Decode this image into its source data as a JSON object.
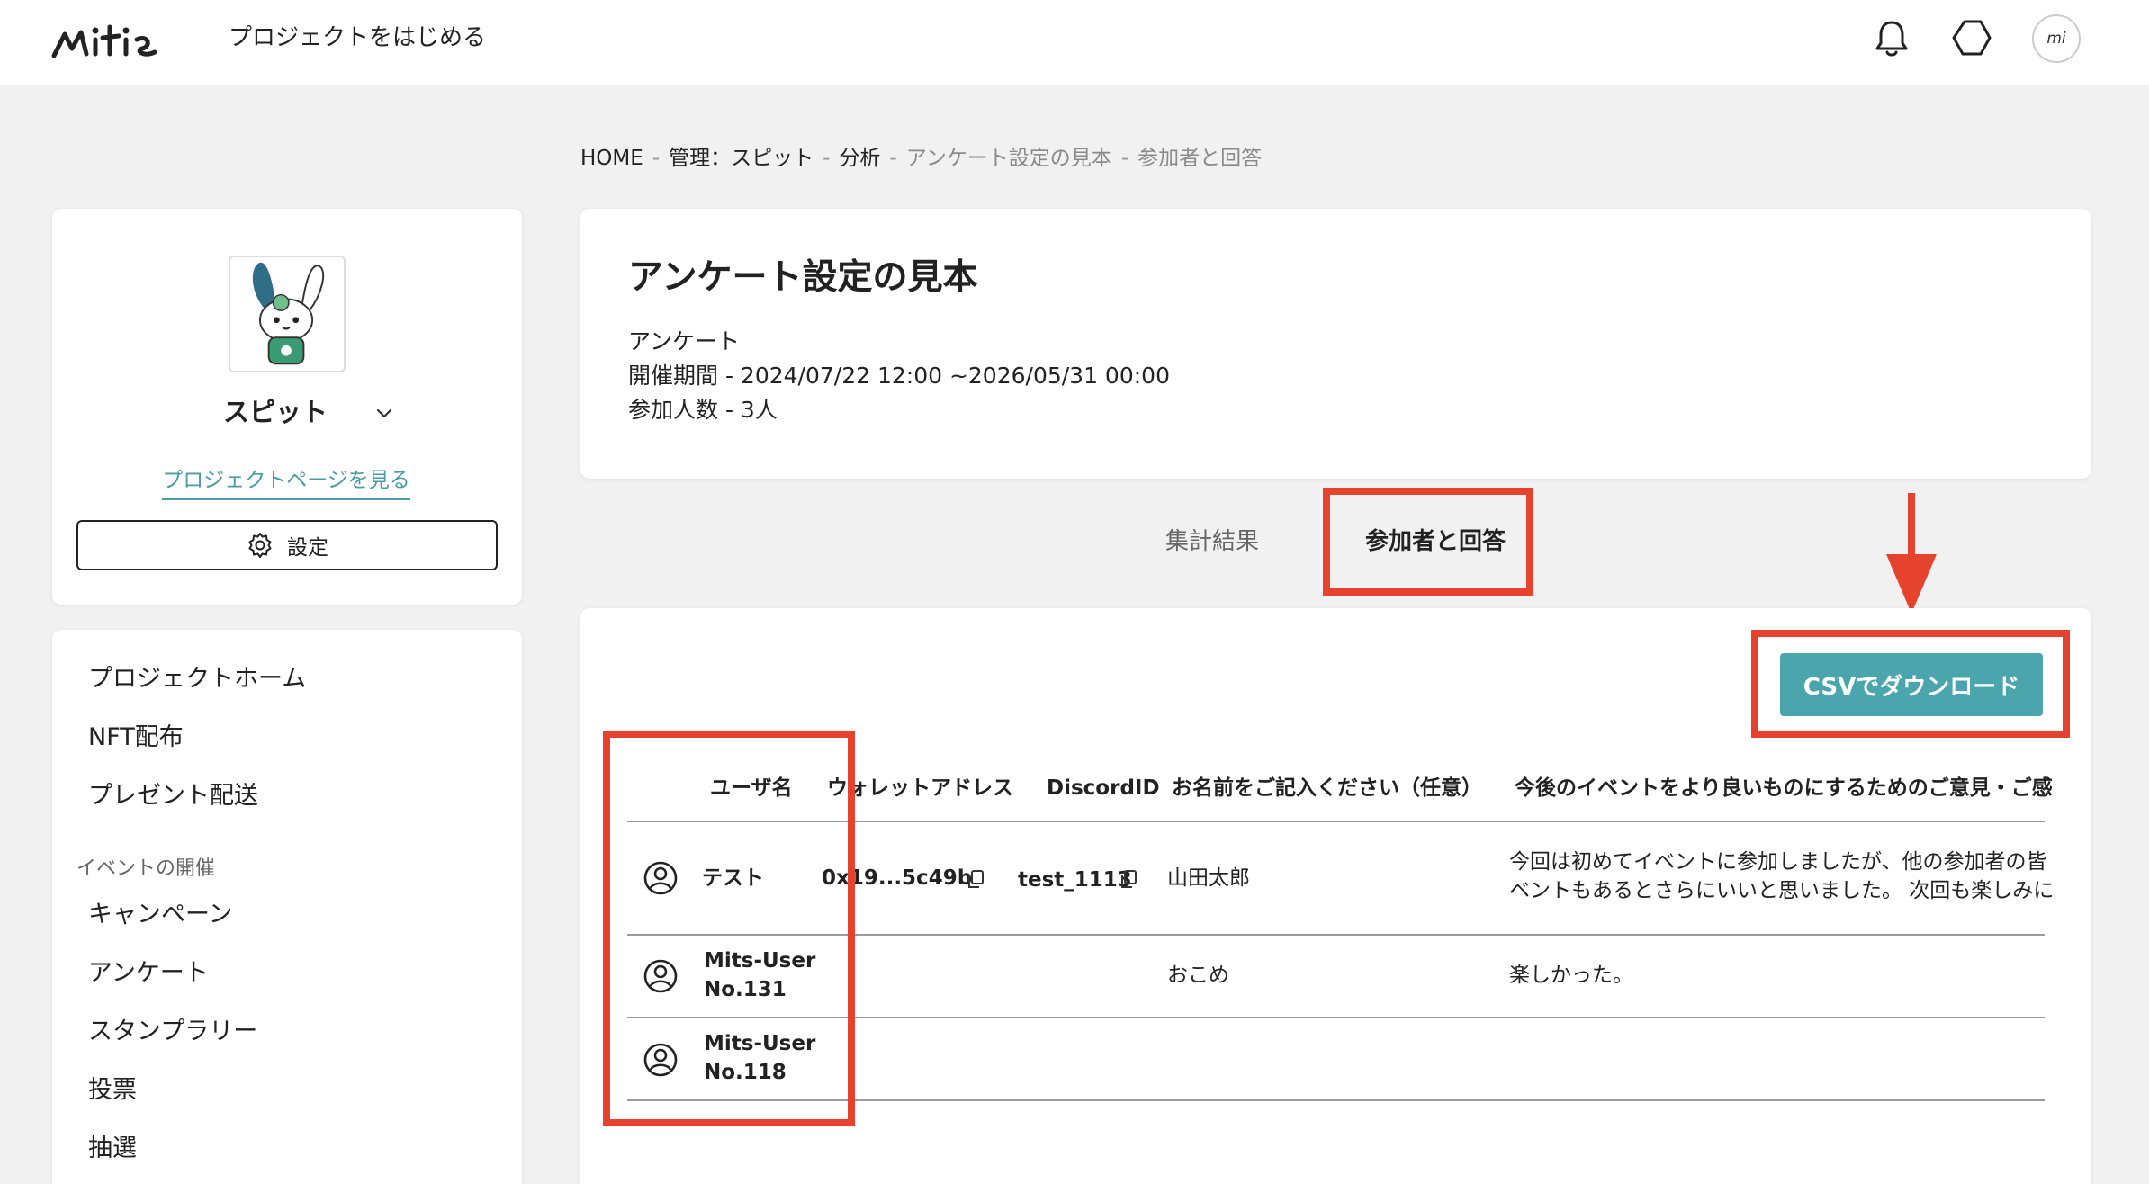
{
  "header": {
    "logo_text": "mits",
    "start_project": "プロジェクトをはじめる",
    "avatar_text": "mi"
  },
  "breadcrumb": {
    "home": "HOME",
    "manage": "管理：スピット",
    "analysis": "分析",
    "survey": "アンケート設定の見本",
    "current": "参加者と回答",
    "separator": "-"
  },
  "profile": {
    "name": "スピット",
    "view_page_link": "プロジェクトページを見る",
    "settings_label": "設定"
  },
  "nav": {
    "items": [
      "プロジェクトホーム",
      "NFT配布",
      "プレゼント配送"
    ],
    "section_label": "イベントの開催",
    "event_items": [
      "キャンペーン",
      "アンケート",
      "スタンプラリー",
      "投票",
      "抽選"
    ]
  },
  "survey": {
    "title": "アンケート設定の見本",
    "type": "アンケート",
    "period": "開催期間 - 2024/07/22 12:00 ~2026/05/31 00:00",
    "participants": "参加人数 - 3人"
  },
  "tabs": {
    "summary": "集計結果",
    "participants": "参加者と回答"
  },
  "csv_button": "CSVでダウンロード",
  "table": {
    "headers": [
      "ユーザ名",
      "ウォレットアドレス",
      "DiscordID",
      "お名前をご記入ください（任意）",
      "今後のイベントをより良いものにするためのご意見・ご感"
    ],
    "rows": [
      {
        "user": "テスト",
        "wallet": "0x19...5c49b",
        "discord": "test_1113",
        "name": "山田太郎",
        "comment_line1": "今回は初めてイベントに参加しましたが、他の参加者の皆",
        "comment_line2": "ベントもあるとさらにいいと思いました。 次回も楽しみに"
      },
      {
        "user_line1": "Mits-User",
        "user_line2": "No.131",
        "name": "おこめ",
        "comment": "楽しかった。"
      },
      {
        "user_line1": "Mits-User",
        "user_line2": "No.118"
      }
    ]
  },
  "colors": {
    "accent": "#4aa5ad",
    "highlight": "#e5432e",
    "link": "#4a9ba3",
    "background": "#f1f1f1"
  }
}
